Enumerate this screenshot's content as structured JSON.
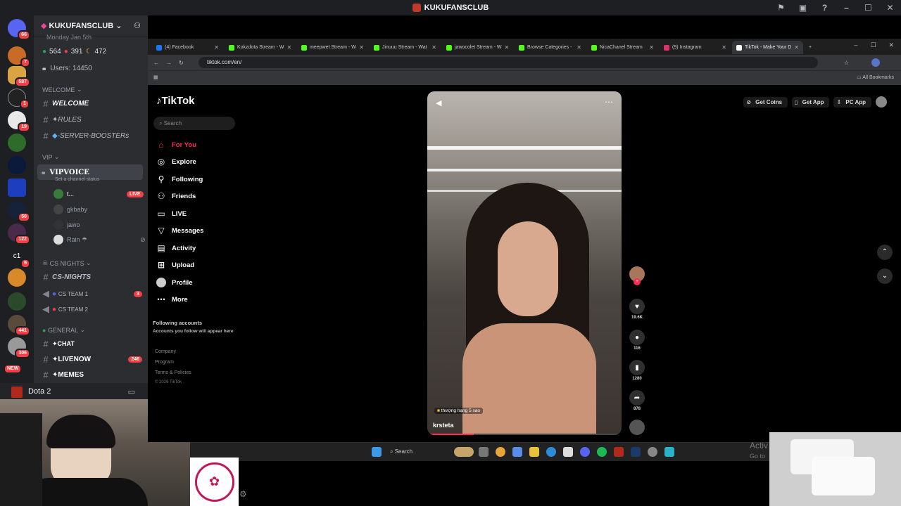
{
  "discord": {
    "window_title": "KUKUFANSCLUB",
    "server_name": "KUKUFANSCLUB",
    "top_line": "Monday Jan 5th",
    "stats": {
      "online": "564",
      "dnd": "391",
      "idle": "472"
    },
    "users": "Users: 14450",
    "categories": {
      "welcome": "WELCOME",
      "vip": "VIP",
      "csnights": "CS NIGHTS",
      "general": "GENERAL"
    },
    "channels": {
      "welcome": "WELCOME",
      "rules": "✦RULES",
      "boosters": "-SERVER-BOOSTERs",
      "vipvoice": "VIPVOICE",
      "vip_status": "Set a channel status",
      "csnights": "CS-NIGHTS",
      "csteam1": "CS TEAM 1",
      "csteam2": "CS TEAM 2",
      "chat": "✦CHAT",
      "livenow": "✦LIVENOW",
      "memes": "✦MEMES"
    },
    "badges": {
      "csteam1": "3",
      "livenow": "246",
      "live": "LIVE"
    },
    "voice_users": [
      "t...",
      "gkbaby",
      "jawo",
      "Rain ☂"
    ],
    "server_badges": [
      "66",
      "7",
      "587",
      "1",
      "19",
      "50",
      "122",
      "5",
      "441",
      "306",
      "NEW"
    ],
    "server_initials": "c1",
    "activity": "Dota 2"
  },
  "browser": {
    "tabs": [
      {
        "label": "(4) Facebook",
        "color": "#1877f2"
      },
      {
        "label": "Kokzdota Stream - W",
        "color": "#53fc18"
      },
      {
        "label": "meepwet Stream - W",
        "color": "#53fc18"
      },
      {
        "label": "Jinuuu Stream - Wat",
        "color": "#53fc18"
      },
      {
        "label": "jawocolet Stream - W",
        "color": "#53fc18"
      },
      {
        "label": "Browse Categories -",
        "color": "#53fc18"
      },
      {
        "label": "NicaChanel Stream",
        "color": "#53fc18"
      },
      {
        "label": "(9) Instagram",
        "color": "#e1306c"
      },
      {
        "label": "TikTok - Make Your D",
        "color": "#ffffff"
      }
    ],
    "url": "tiktok.com/en/",
    "bookmarks": "All Bookmarks"
  },
  "tiktok": {
    "logo": "TikTok",
    "search_placeholder": "Search",
    "nav": [
      "For You",
      "Explore",
      "Following",
      "Friends",
      "LIVE",
      "Messages",
      "Activity",
      "Upload",
      "Profile",
      "More"
    ],
    "following_title": "Following accounts",
    "following_sub": "Accounts you follow will appear here",
    "footer": [
      "Company",
      "Program",
      "Terms & Policies",
      "© 2026 TikTok"
    ],
    "topbar": [
      "Get Coins",
      "Get App",
      "PC App"
    ],
    "video_user": "krsteta",
    "video_caption": "thượng hạng 5 sao",
    "counts": {
      "likes": "19.6K",
      "comments": "116",
      "saves": "1280",
      "shares": "878"
    }
  },
  "taskbar": {
    "search": "Search"
  },
  "overlay": {
    "activate": "Activ",
    "goto": "Go to"
  }
}
